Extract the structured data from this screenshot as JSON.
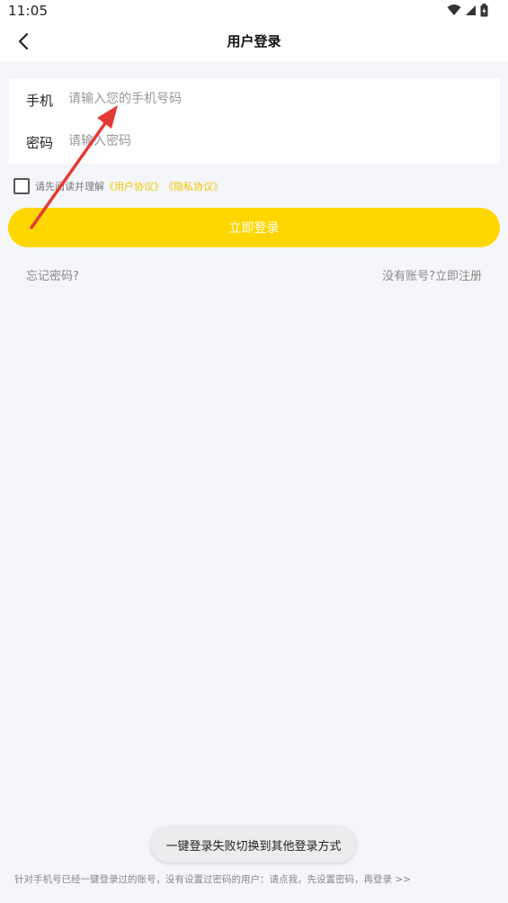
{
  "status_bar": {
    "time": "11:05",
    "icons": [
      "wifi-icon",
      "signal-icon",
      "battery-icon"
    ]
  },
  "nav": {
    "title": "用户登录",
    "back_icon": "chevron-left-icon"
  },
  "form": {
    "phone_label": "手机",
    "phone_placeholder": "请输入您的手机号码",
    "phone_value": "",
    "password_label": "密码",
    "password_placeholder": "请输入密码",
    "password_value": ""
  },
  "agreement": {
    "checked": false,
    "prefix": "请先阅读并理解",
    "user_agreement": "《用户协议》",
    "privacy_policy": "《隐私协议》"
  },
  "login_button": "立即登录",
  "forgot_password": "忘记密码?",
  "register": "没有账号?立即注册",
  "toast": "一键登录失败切换到其他登录方式",
  "bottom_tip": "针对手机号已经一键登录过的账号，没有设置过密码的用户：请点我，先设置密码，再登录 >>",
  "colors": {
    "accent": "#ffd600",
    "link": "#f0c400",
    "background": "#f5f6fa",
    "annotation_arrow": "#e53935"
  }
}
